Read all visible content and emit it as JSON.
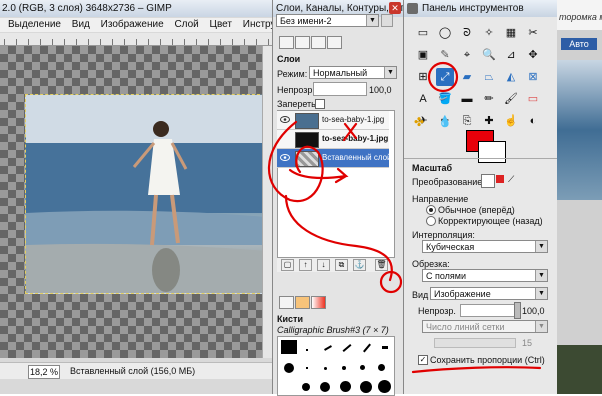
{
  "main_window": {
    "title": "2.0 (RGB, 3 слоя) 3648x2736 – GIMP",
    "menu": [
      "Выделение",
      "Вид",
      "Изображение",
      "Слой",
      "Цвет",
      "Инструменты"
    ],
    "zoom": "18,2 %",
    "status_text": "Вставленный слой (156,0 МБ)"
  },
  "layers_dock": {
    "title": "Слои, Каналы, Контуры, Отме",
    "image_select": "Без имени-2",
    "section_label": "Слои",
    "mode_label": "Режим:",
    "mode_value": "Нормальный",
    "opacity_label": "Непрозр.:",
    "opacity_value": "100,0",
    "lock_label": "Запереть:",
    "layers": [
      {
        "name": "to-sea-baby-1.jpg",
        "selected": false
      },
      {
        "name": "to-sea-baby-1.jpg",
        "selected": false
      },
      {
        "name": "Вставленный слой",
        "selected": true
      }
    ],
    "brushes_label": "Кисти",
    "brush_name": "Calligraphic Brush#3 (7 × 7)"
  },
  "toolbox": {
    "title": "Панель инструментов",
    "foreground_color": "#e8000a",
    "background_color": "#ffffff",
    "tool_title": "Масштаб",
    "transform_label": "Преобразование:",
    "direction_label": "Направление",
    "direction_options": [
      {
        "label": "Обычное (вперёд)",
        "checked": true
      },
      {
        "label": "Корректирующее (назад)",
        "checked": false
      }
    ],
    "interpolation_label": "Интерполяция:",
    "interpolation_value": "Кубическая",
    "clipping_label": "Обрезка:",
    "clipping_value": "С полями",
    "view_label": "Вид",
    "view_value": "Изображение",
    "opacity_label": "Непрозр.",
    "opacity_value": "100,0",
    "grid_lines_value": "Число линий сетки",
    "grid_count": "15",
    "keep_aspect_label": "Сохранить пропорции  (Ctrl)",
    "keep_aspect_checked": true
  },
  "right_sliver": {
    "text": "торомка м",
    "button_label": "Авто"
  },
  "annotation_color": "#e00000"
}
